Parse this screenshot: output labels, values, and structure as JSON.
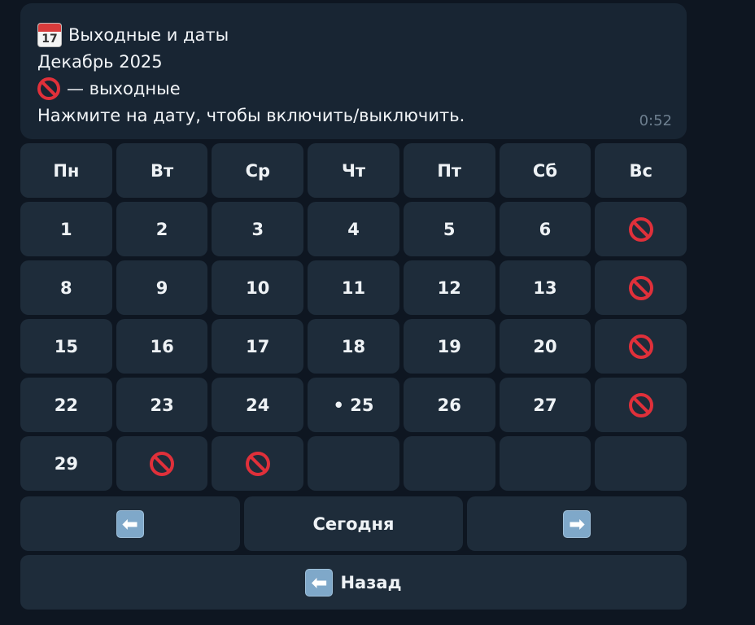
{
  "message": {
    "line1_text": "Выходные и даты",
    "line1_icon": "calendar-icon",
    "calendar_icon_number": "17",
    "line2_text": "Декабрь 2025",
    "line3_icon": "forbidden-icon",
    "line3_text": "— выходные",
    "line4_text": "Нажмите на дату, чтобы включить/выключить.",
    "time": "0:52"
  },
  "calendar": {
    "weekdays": [
      "Пн",
      "Вт",
      "Ср",
      "Чт",
      "Пт",
      "Сб",
      "Вс"
    ],
    "weeks": [
      [
        "1",
        "2",
        "3",
        "4",
        "5",
        "6",
        "🚫"
      ],
      [
        "8",
        "9",
        "10",
        "11",
        "12",
        "13",
        "🚫"
      ],
      [
        "15",
        "16",
        "17",
        "18",
        "19",
        "20",
        "🚫"
      ],
      [
        "22",
        "23",
        "24",
        "• 25",
        "26",
        "27",
        "🚫"
      ],
      [
        "29",
        "🚫",
        "🚫",
        "",
        "",
        "",
        ""
      ]
    ],
    "nav": {
      "prev_icon": "left-arrow-icon",
      "today_label": "Сегодня",
      "next_icon": "right-arrow-icon"
    },
    "back_icon": "left-arrow-icon",
    "back_label": "Назад"
  },
  "colors": {
    "background": "#0e1621",
    "message_bubble": "#182533",
    "button": "#1e2c3a",
    "forbidden_red": "#e0303a",
    "time_gray": "#6d7f8f"
  }
}
